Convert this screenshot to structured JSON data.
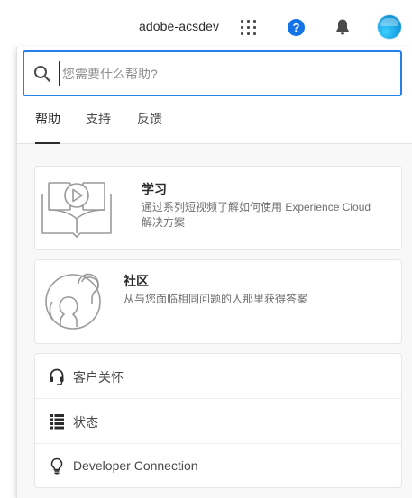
{
  "header": {
    "org_name": "adobe-acsdev",
    "help_glyph": "?",
    "icons": [
      "apps-grid-icon",
      "help-icon",
      "bell-icon",
      "avatar"
    ]
  },
  "search": {
    "placeholder": "您需要什么帮助?",
    "value": ""
  },
  "tabs": [
    {
      "label": "帮助",
      "active": true
    },
    {
      "label": "支持",
      "active": false
    },
    {
      "label": "反馈",
      "active": false
    }
  ],
  "cards": [
    {
      "title": "学习",
      "description_line1": "通过系列短视频了解如何使用 Experience Cloud",
      "description_line2": "解决方案",
      "icon": "book-video-icon"
    },
    {
      "title": "社区",
      "description": "从与您面临相同问题的人那里获得答案",
      "icon": "community-icon"
    }
  ],
  "links": [
    {
      "label": "客户关怀",
      "icon": "headset-icon"
    },
    {
      "label": "状态",
      "icon": "status-list-icon"
    },
    {
      "label": "Developer Connection",
      "icon": "lightbulb-icon"
    }
  ],
  "colors": {
    "accent": "#1473e6",
    "focus_border": "#2680eb",
    "avatar": "#1ba8e6",
    "text": "#2c2c2c",
    "muted_text": "#6e6e6e"
  }
}
